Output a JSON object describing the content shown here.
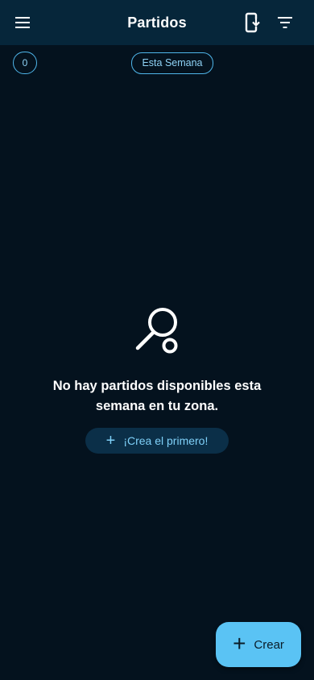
{
  "header": {
    "title": "Partidos",
    "menu_icon": "hamburger-menu-icon",
    "download_icon": "phone-download-icon",
    "filter_icon": "filter-icon"
  },
  "filters": {
    "count": "0",
    "week_label": "Esta Semana"
  },
  "empty_state": {
    "icon": "racket-ball-icon",
    "message": "No hay partidos disponibles esta semana en tu zona.",
    "action_label": "¡Crea el primero!"
  },
  "fab": {
    "label": "Crear"
  },
  "colors": {
    "background": "#04121e",
    "appbar": "#06263a",
    "accent": "#5ac3f4"
  }
}
